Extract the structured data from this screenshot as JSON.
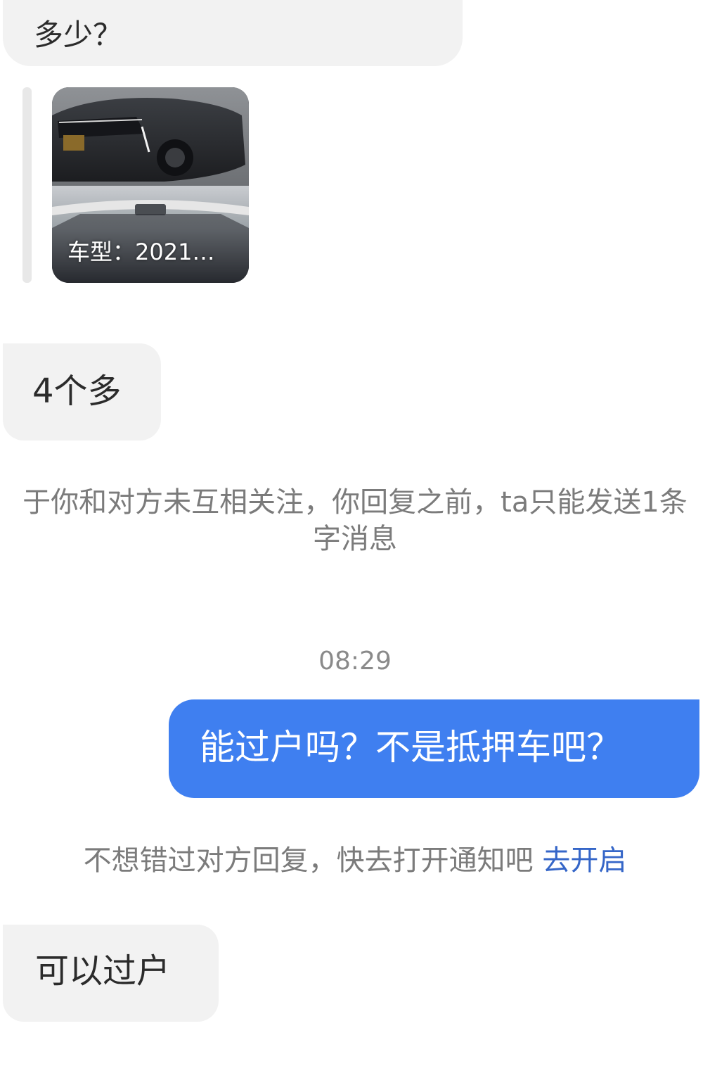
{
  "messages": {
    "top": "多少？",
    "card_caption": "车型：2021…",
    "price": "4个多",
    "system_note_line1": "于你和对方未互相关注，你回复之前，ta只能发送1条",
    "system_note_line2": "字消息",
    "timestamp": "08:29",
    "outgoing": "能过户吗？不是抵押车吧？",
    "notify_text": "不想错过对方回复，快去打开通知吧",
    "notify_link": "去开启",
    "reply_in": "可以过户"
  },
  "colors": {
    "outgoing_bubble": "#3f7ff0",
    "incoming_bubble": "#f2f2f2",
    "link": "#3566c8"
  }
}
